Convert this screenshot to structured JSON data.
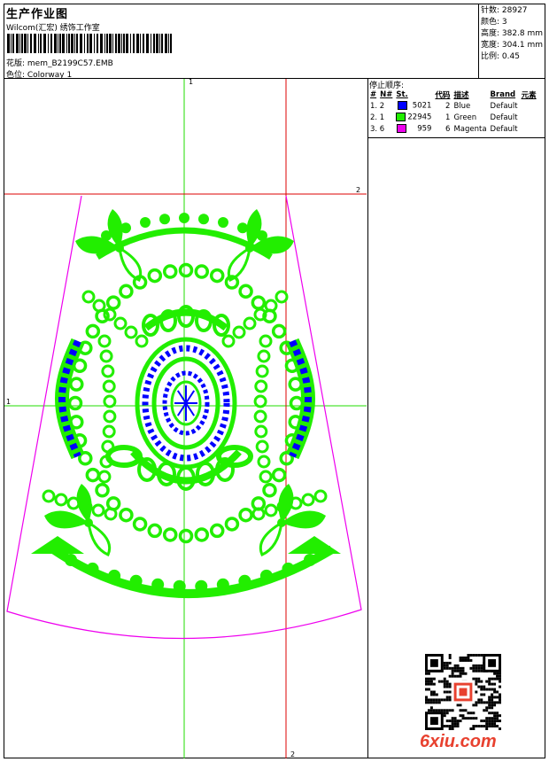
{
  "header": {
    "title": "生产作业图",
    "subtitle": "Wilcom(汇宏) 绣饰工作室",
    "design_label": "花版: mem_B2199C57.EMB",
    "colorway_label": "色位:  Colorway 1"
  },
  "stats": [
    "针数: 28927",
    "颜色: 3",
    "高度: 382.8 mm",
    "宽度: 304.1 mm",
    "比例: 0.45"
  ],
  "legend": {
    "title": "停止顺序:",
    "columns": [
      "#",
      "N#",
      "St.",
      "代码",
      "描述",
      "Brand",
      "元素"
    ],
    "rows": [
      {
        "seq": "1. 2",
        "color": "#0000ff",
        "stitches": "5021",
        "code": "2",
        "desc": "Blue",
        "brand": "Default"
      },
      {
        "seq": "2. 1",
        "color": "#22ee00",
        "stitches": "22945",
        "code": "1",
        "desc": "Green",
        "brand": "Default"
      },
      {
        "seq": "3. 6",
        "color": "#ee00ee",
        "stitches": "959",
        "code": "6",
        "desc": "Magenta",
        "brand": "Default"
      }
    ]
  },
  "axis_labels": {
    "top_vertical": "1",
    "left_horizontal": "1",
    "right_horizontal": "2",
    "bottom_vertical": "2"
  },
  "colors": {
    "green": "#22ee00",
    "blue": "#0000ff",
    "magenta": "#ee00ee",
    "red_guide": "#dd0000",
    "green_guide": "#22dd00"
  },
  "watermark": "6xiu.com"
}
